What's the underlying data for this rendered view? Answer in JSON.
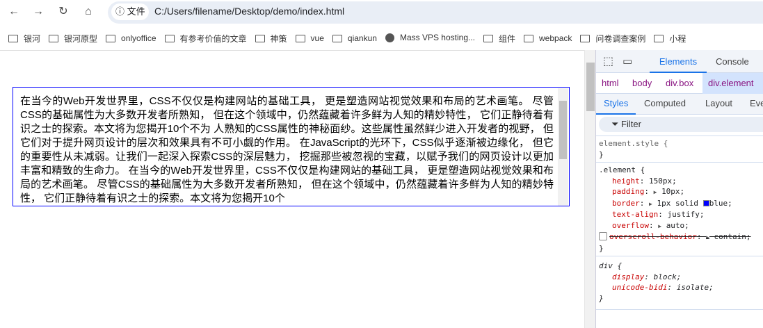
{
  "browser": {
    "chip_label": "文件",
    "url": "C:/Users/filename/Desktop/demo/index.html",
    "bookmarks": [
      {
        "label": "银河",
        "icon": "folder-icon"
      },
      {
        "label": "银河原型",
        "icon": "folder-icon"
      },
      {
        "label": "onlyoffice",
        "icon": "folder-icon"
      },
      {
        "label": "有参考价值的文章",
        "icon": "folder-icon"
      },
      {
        "label": "神策",
        "icon": "folder-icon"
      },
      {
        "label": "vue",
        "icon": "folder-icon"
      },
      {
        "label": "qiankun",
        "icon": "folder-icon"
      },
      {
        "label": "Mass VPS hosting...",
        "icon": "globe-icon"
      },
      {
        "label": "组件",
        "icon": "folder-icon"
      },
      {
        "label": "webpack",
        "icon": "folder-icon"
      },
      {
        "label": "问卷调查案例",
        "icon": "folder-icon"
      },
      {
        "label": "小程",
        "icon": "folder-icon"
      }
    ]
  },
  "page": {
    "text": "在当今的Web开发世界里，CSS不仅仅是构建网站的基础工具， 更是塑造网站视觉效果和布局的艺术画笔。 尽管CSS的基础属性为大多数开发者所熟知， 但在这个领域中，仍然蕴藏着许多鲜为人知的精妙特性， 它们正静待着有识之士的探索。本文将为您揭开10个不为 人熟知的CSS属性的神秘面纱。这些属性虽然鲜少进入开发者的视野， 但它们对于提升网页设计的层次和效果具有不可小觑的作用。 在JavaScript的光环下，CSS似乎逐渐被边缘化， 但它的重要性从未减弱。让我们一起深入探索CSS的深层魅力， 挖掘那些被忽视的宝藏，以赋予我们的网页设计以更加丰富和精致的生命力。 在当今的Web开发世界里，CSS不仅仅是构建网站的基础工具， 更是塑造网站视觉效果和布局的艺术画笔。 尽管CSS的基础属性为大多数开发者所熟知， 但在这个领域中，仍然蕴藏着许多鲜为人知的精妙特性， 它们正静待着有识之士的探索。本文将为您揭开10个"
  },
  "devtools": {
    "tabs": [
      "Elements",
      "Console"
    ],
    "breadcrumbs": [
      "html",
      "body",
      "div.box",
      "div.element"
    ],
    "subtabs": [
      "Styles",
      "Computed",
      "Layout",
      "Eve"
    ],
    "filter_placeholder": "Filter",
    "element_style": {
      "selector": "element.style {",
      "close": "}"
    },
    "element_rule": {
      "selector": ".element {",
      "props": [
        {
          "name": "height",
          "value": "150px;"
        },
        {
          "name": "padding",
          "value": "10px;"
        },
        {
          "name": "border",
          "value": "1px solid ",
          "extra": "blue;"
        },
        {
          "name": "text-align",
          "value": "justify;"
        },
        {
          "name": "overflow",
          "value": "auto;"
        },
        {
          "name": "overscroll-behavior",
          "value": "contain;"
        }
      ],
      "close": "}"
    },
    "ua_rule": {
      "selector": "div {",
      "props": [
        {
          "name": "display",
          "value": "block;"
        },
        {
          "name": "unicode-bidi",
          "value": "isolate;"
        }
      ],
      "close": "}"
    },
    "colors": {
      "accent": "#1a73e8",
      "prop": "#c80000",
      "swatch": "#0000ff"
    }
  }
}
